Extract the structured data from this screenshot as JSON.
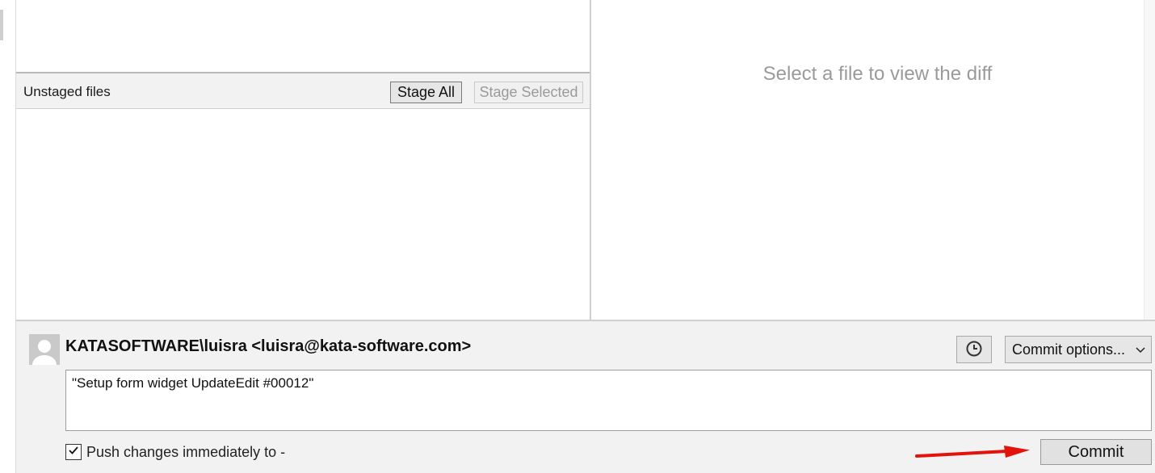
{
  "unstaged": {
    "title": "Unstaged files",
    "stage_all_label": "Stage All",
    "stage_selected_label": "Stage Selected"
  },
  "diff": {
    "placeholder": "Select a file to view the diff"
  },
  "commit": {
    "author": "KATASOFTWARE\\luisra <luisra@kata-software.com>",
    "options_label": "Commit options...",
    "message": "\"Setup form widget UpdateEdit #00012\"",
    "push_label": "Push changes immediately to -",
    "push_checked": true,
    "commit_label": "Commit"
  },
  "icons": {
    "history": "clock-icon",
    "options_dropdown": "chevron-down-icon",
    "avatar": "user-avatar-icon",
    "annotation": "red-arrow-icon"
  },
  "colors": {
    "annotation_arrow": "#e3120b",
    "panel_bg": "#f2f2f2",
    "placeholder_text": "#9a9a9a"
  }
}
